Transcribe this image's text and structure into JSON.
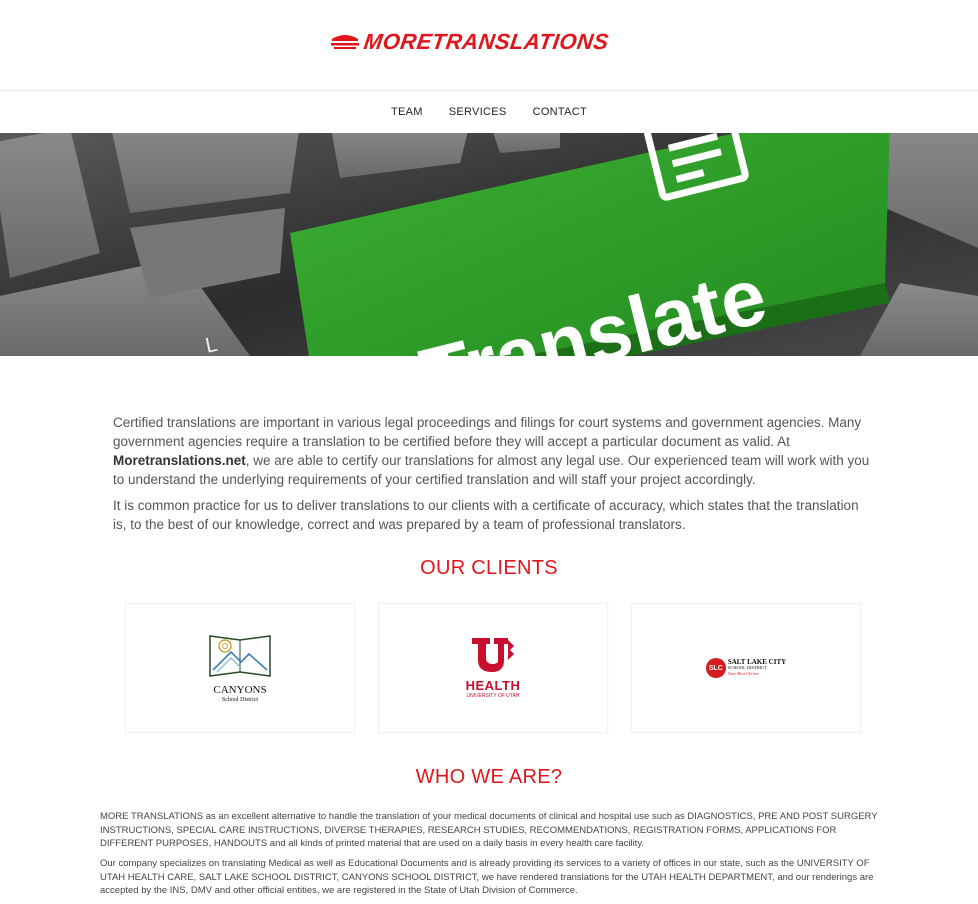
{
  "brand": {
    "name": "MORETRANSLATIONS",
    "color": "#e1161d"
  },
  "nav": {
    "items": [
      "TEAM",
      "SERVICES",
      "CONTACT"
    ]
  },
  "hero": {
    "key_label": "Translate",
    "image": "keyboard-translate-key"
  },
  "intro": {
    "p1_start": "Certified translations are important in various legal proceedings and filings for court systems and government agencies. Many government agencies require a translation to be certified before they will accept a particular document as valid. At ",
    "p1_bold": "Moretranslations.net",
    "p1_end": ", we are able to certify our translations for almost any legal use. Our experienced team will work with you to understand the underlying requirements of your certified translation and will staff your project accordingly.",
    "p2": "It is common practice for us to deliver translations to our clients with a certificate of accuracy, which states that the translation is, to the best of our knowledge, correct and was prepared by a team of professional translators."
  },
  "clients": {
    "title": "OUR CLIENTS",
    "items": [
      {
        "name": "CANYONS",
        "sub": "School District",
        "icon": "canyons-logo"
      },
      {
        "name": "HEALTH",
        "sub": "UNIVERSITY OF UTAH",
        "icon": "u-of-u-health-logo"
      },
      {
        "name": "SALT LAKE CITY",
        "sub": "SCHOOL DISTRICT",
        "tagline": "Your Best Choice",
        "mark": "SLC",
        "icon": "slc-school-district-logo"
      }
    ]
  },
  "about": {
    "title": "WHO WE ARE?",
    "p1": "MORE TRANSLATIONS as an excellent alternative to handle the translation of your medical documents of clinical and hospital use such as DIAGNOSTICS, PRE AND POST SURGERY INSTRUCTIONS, SPECIAL CARE INSTRUCTIONS, DIVERSE THERAPIES, RESEARCH STUDIES, RECOMMENDATIONS, REGISTRATION FORMS, APPLICATIONS FOR DIFFERENT PURPOSES, HANDOUTS and all kinds of printed material that are used on a daily basis in every health care facility.",
    "p2": "Our company specializes on translating Medical as well as Educational Documents and is already providing its services to a variety of offices in our state, such as the UNIVERSITY OF UTAH HEALTH CARE, SALT LAKE SCHOOL DISTRICT, CANYONS SCHOOL DISTRICT, we have rendered translations for the UTAH HEALTH DEPARTMENT, and our renderings are accepted by the INS, DMV and other official entities, we are registered in the State of Utah Division of Commerce."
  },
  "colors": {
    "accent": "#e1161d",
    "key_green": "#2f9e2a",
    "text": "#555555"
  }
}
